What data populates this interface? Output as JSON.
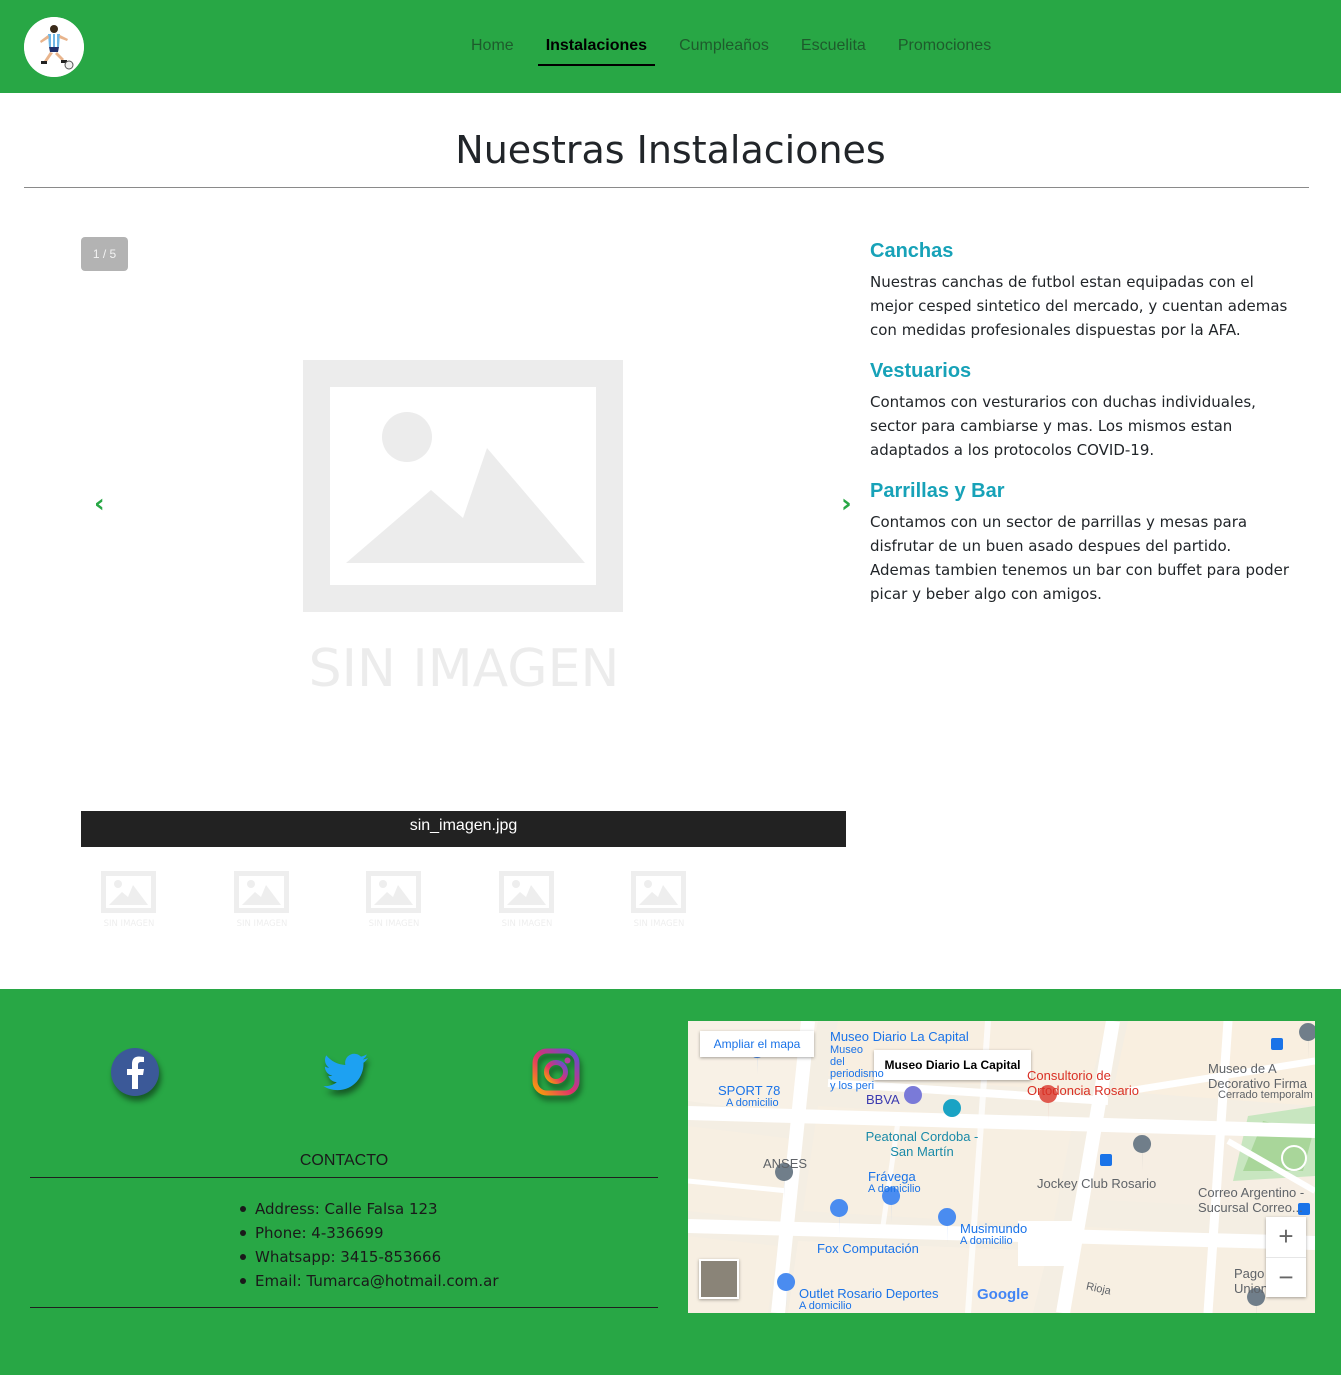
{
  "nav": {
    "items": [
      {
        "label": "Home",
        "active": false
      },
      {
        "label": "Instalaciones",
        "active": true
      },
      {
        "label": "Cumpleaños",
        "active": false
      },
      {
        "label": "Escuelita",
        "active": false
      },
      {
        "label": "Promociones",
        "active": false
      }
    ]
  },
  "page": {
    "title": "Nuestras Instalaciones"
  },
  "gallery": {
    "counter": "1 / 5",
    "prev_icon": "chevron-left-icon",
    "next_icon": "chevron-right-icon",
    "image_text": "SIN IMAGEN",
    "caption": "sin_imagen.jpg",
    "thumbnail_count": 5,
    "thumbnail_text": "SIN IMAGEN"
  },
  "features": [
    {
      "title": "Canchas",
      "text": "Nuestras canchas de futbol estan equipadas con el mejor cesped sintetico del mercado, y cuentan ademas con medidas profesionales dispuestas por la AFA."
    },
    {
      "title": "Vestuarios",
      "text": "Contamos con vesturarios con duchas individuales, sector para cambiarse y mas. Los mismos estan adaptados a los protocolos COVID-19."
    },
    {
      "title": "Parrillas y Bar",
      "text": "Contamos con un sector de parrillas y mesas para disfrutar de un buen asado despues del partido. Ademas tambien tenemos un bar con buffet para poder picar y beber algo con amigos."
    }
  ],
  "footer": {
    "social": [
      "facebook-icon",
      "twitter-icon",
      "instagram-icon"
    ],
    "contact_title": "CONTACTO",
    "contact": [
      "Address: Calle Falsa 123",
      "Phone: 4-336699",
      "Whatsapp: 3415-853666",
      "Email: Tumarca@hotmail.com.ar"
    ]
  },
  "map": {
    "enlarge_label": "Ampliar el mapa",
    "popup_label": "Museo Diario La Capital",
    "places": {
      "museo": "Museo Diario La Capital",
      "museo_sub": "Museo del periodismo y los peri",
      "consultorio": "Consultorio de Ortodoncia Rosario",
      "museo_arte": "Museo de A Decorativo Firma",
      "cerrado": "Cerrado temporalm",
      "sport78": "SPORT 78",
      "domicilio": "A domicilio",
      "bbva": "BBVA",
      "peatonal": "Peatonal Cordoba - San Martín",
      "anses": "ANSES",
      "fravega": "Frávega",
      "jockey": "Jockey Club Rosario",
      "correo": "Correo Argentino - Sucursal Correo...",
      "musimundo": "Musimundo",
      "fox": "Fox Computación",
      "outlet": "Outlet Rosario Deportes",
      "pago": "Pago Union",
      "rioja": "Rioja",
      "google": "Google"
    },
    "zoom_in": "+",
    "zoom_out": "−"
  },
  "colors": {
    "primary_green": "#28a745",
    "feature_title": "#17a2b8"
  }
}
